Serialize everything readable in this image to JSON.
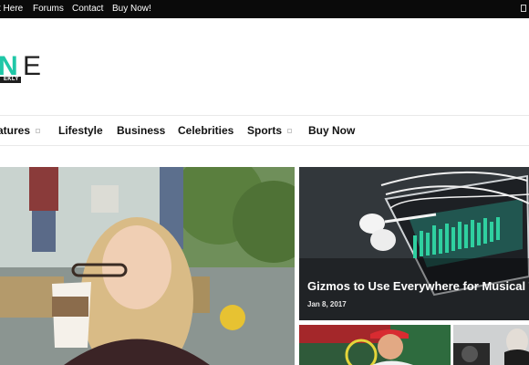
{
  "topbar": {
    "links": [
      "t Here",
      "Forums",
      "Contact",
      "Buy Now!"
    ]
  },
  "logo": {
    "letters_accent": "N",
    "letters_main": "E",
    "tagline": "EKLY"
  },
  "nav": {
    "items": [
      "atures",
      "Lifestyle",
      "Business",
      "Celebrities",
      "Sports",
      "Buy Now"
    ]
  },
  "featured": {
    "main_post": {},
    "side_post": {
      "title": "Gizmos to Use Everywhere for Musical T",
      "date": "Jan 8, 2017"
    }
  },
  "colors": {
    "accent": "#1fc7a7",
    "topbar_bg": "#0a0a0a"
  }
}
